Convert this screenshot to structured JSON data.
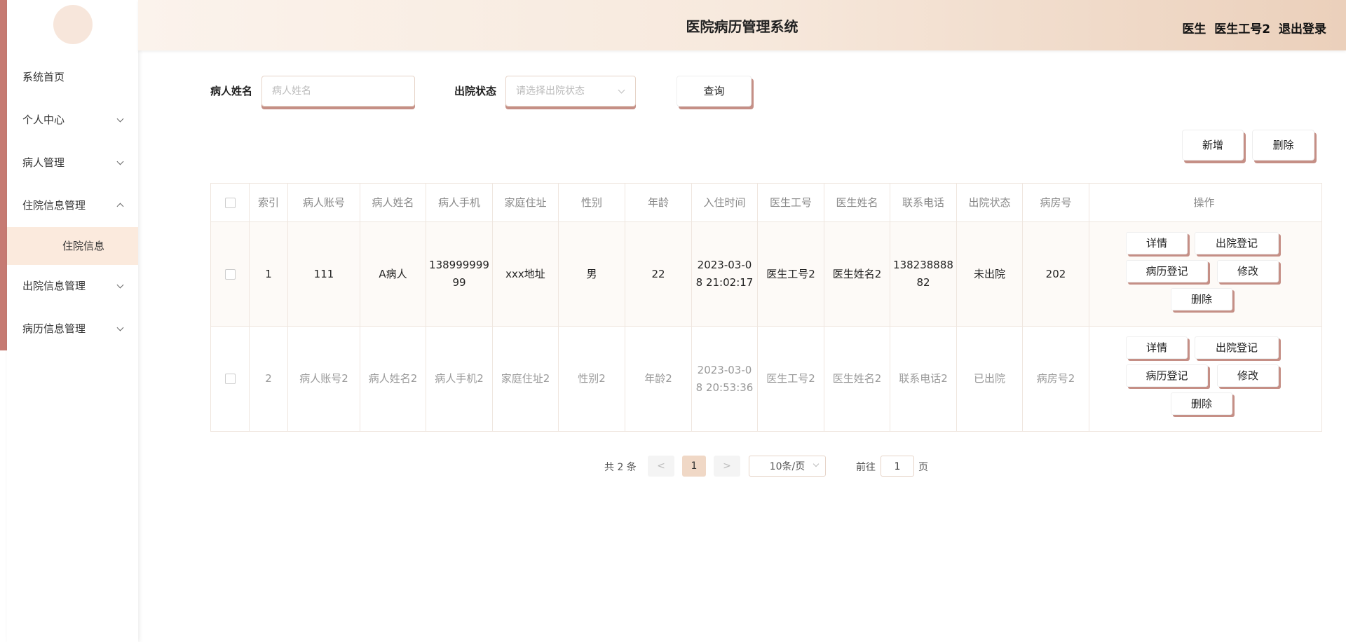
{
  "header": {
    "title": "医院病历管理系统",
    "role": "医生",
    "username": "医生工号2",
    "logout": "退出登录"
  },
  "sidebar": {
    "items": [
      {
        "label": "系统首页"
      },
      {
        "label": "个人中心"
      },
      {
        "label": "病人管理"
      },
      {
        "label": "住院信息管理"
      },
      {
        "label": "出院信息管理"
      },
      {
        "label": "病历信息管理"
      }
    ],
    "active_sub": "住院信息"
  },
  "search": {
    "name_label": "病人姓名",
    "name_placeholder": "病人姓名",
    "status_label": "出院状态",
    "status_placeholder": "请选择出院状态",
    "query_btn": "查询"
  },
  "actions": {
    "add": "新增",
    "delete": "删除"
  },
  "table": {
    "columns": [
      "索引",
      "病人账号",
      "病人姓名",
      "病人手机",
      "家庭住址",
      "性别",
      "年龄",
      "入住时间",
      "医生工号",
      "医生姓名",
      "联系电话",
      "出院状态",
      "病房号",
      "操作"
    ],
    "rows": [
      [
        "1",
        "111",
        "A病人",
        "13899999999",
        "xxx地址",
        "男",
        "22",
        "2023-03-08 21:02:17",
        "医生工号2",
        "医生姓名2",
        "13823888882",
        "未出院",
        "202"
      ],
      [
        "2",
        "病人账号2",
        "病人姓名2",
        "病人手机2",
        "家庭住址2",
        "性别2",
        "年龄2",
        "2023-03-08 20:53:36",
        "医生工号2",
        "医生姓名2",
        "联系电话2",
        "已出院",
        "病房号2"
      ]
    ],
    "ops": {
      "detail": "详情",
      "discharge": "出院登记",
      "record": "病历登记",
      "edit": "修改",
      "delete": "删除"
    }
  },
  "pagination": {
    "total": "共 2 条",
    "prev": "<",
    "current": "1",
    "next": ">",
    "page_size": "10条/页",
    "goto_label": "前往",
    "goto_value": "1",
    "page_unit": "页"
  },
  "colors": {
    "accent": "#c67a72",
    "shadow": "#c58f86",
    "active_bg": "#fbeadd"
  }
}
